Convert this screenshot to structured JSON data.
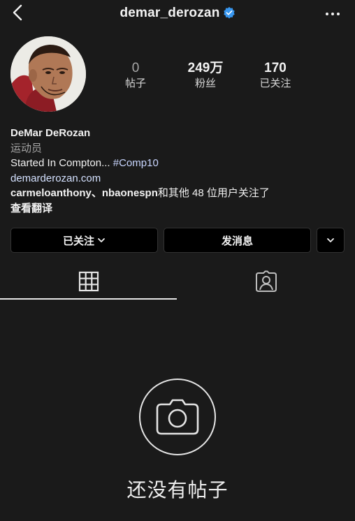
{
  "header": {
    "username": "demar_derozan"
  },
  "stats": {
    "posts": {
      "value": "0",
      "label": "帖子"
    },
    "followers": {
      "value": "249万",
      "label": "粉丝"
    },
    "following": {
      "value": "170",
      "label": "已关注"
    }
  },
  "bio": {
    "name": "DeMar DeRozan",
    "category": "运动员",
    "text": "Started In Compton... ",
    "hashtag": "#Comp10",
    "link": "demarderozan.com",
    "followed_by_users": "carmeloanthony、nbaonespn",
    "followed_by_suffix": "和其他 48 位用户关注了",
    "translate": "查看翻译"
  },
  "actions": {
    "follow_label": "已关注",
    "message_label": "发消息"
  },
  "empty_state": {
    "text": "还没有帖子"
  },
  "colors": {
    "background": "#1a1a1a",
    "verified": "#3897f0",
    "button_bg": "#000000"
  }
}
